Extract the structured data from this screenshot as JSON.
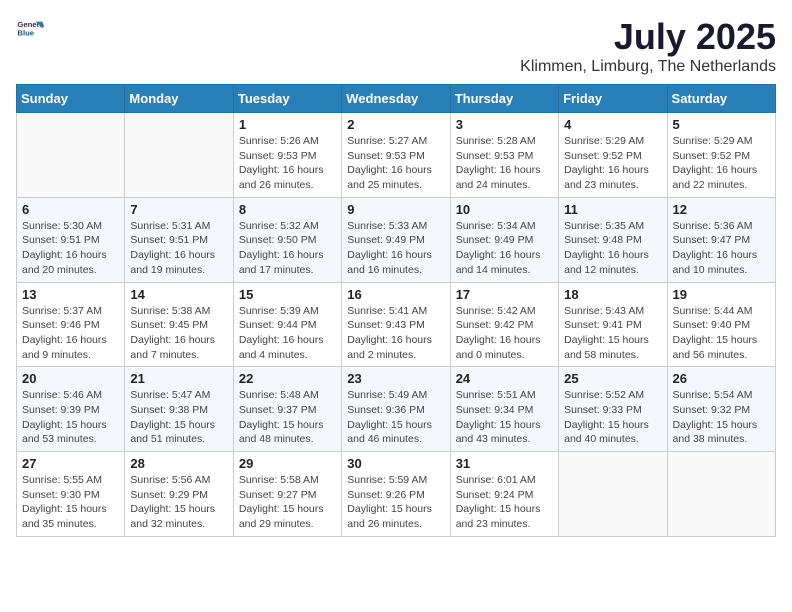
{
  "header": {
    "logo": {
      "general": "General",
      "blue": "Blue"
    },
    "title": "July 2025",
    "location": "Klimmen, Limburg, The Netherlands"
  },
  "calendar": {
    "days_of_week": [
      "Sunday",
      "Monday",
      "Tuesday",
      "Wednesday",
      "Thursday",
      "Friday",
      "Saturday"
    ],
    "weeks": [
      [
        {
          "day": "",
          "content": ""
        },
        {
          "day": "",
          "content": ""
        },
        {
          "day": "1",
          "content": "Sunrise: 5:26 AM\nSunset: 9:53 PM\nDaylight: 16 hours and 26 minutes."
        },
        {
          "day": "2",
          "content": "Sunrise: 5:27 AM\nSunset: 9:53 PM\nDaylight: 16 hours and 25 minutes."
        },
        {
          "day": "3",
          "content": "Sunrise: 5:28 AM\nSunset: 9:53 PM\nDaylight: 16 hours and 24 minutes."
        },
        {
          "day": "4",
          "content": "Sunrise: 5:29 AM\nSunset: 9:52 PM\nDaylight: 16 hours and 23 minutes."
        },
        {
          "day": "5",
          "content": "Sunrise: 5:29 AM\nSunset: 9:52 PM\nDaylight: 16 hours and 22 minutes."
        }
      ],
      [
        {
          "day": "6",
          "content": "Sunrise: 5:30 AM\nSunset: 9:51 PM\nDaylight: 16 hours and 20 minutes."
        },
        {
          "day": "7",
          "content": "Sunrise: 5:31 AM\nSunset: 9:51 PM\nDaylight: 16 hours and 19 minutes."
        },
        {
          "day": "8",
          "content": "Sunrise: 5:32 AM\nSunset: 9:50 PM\nDaylight: 16 hours and 17 minutes."
        },
        {
          "day": "9",
          "content": "Sunrise: 5:33 AM\nSunset: 9:49 PM\nDaylight: 16 hours and 16 minutes."
        },
        {
          "day": "10",
          "content": "Sunrise: 5:34 AM\nSunset: 9:49 PM\nDaylight: 16 hours and 14 minutes."
        },
        {
          "day": "11",
          "content": "Sunrise: 5:35 AM\nSunset: 9:48 PM\nDaylight: 16 hours and 12 minutes."
        },
        {
          "day": "12",
          "content": "Sunrise: 5:36 AM\nSunset: 9:47 PM\nDaylight: 16 hours and 10 minutes."
        }
      ],
      [
        {
          "day": "13",
          "content": "Sunrise: 5:37 AM\nSunset: 9:46 PM\nDaylight: 16 hours and 9 minutes."
        },
        {
          "day": "14",
          "content": "Sunrise: 5:38 AM\nSunset: 9:45 PM\nDaylight: 16 hours and 7 minutes."
        },
        {
          "day": "15",
          "content": "Sunrise: 5:39 AM\nSunset: 9:44 PM\nDaylight: 16 hours and 4 minutes."
        },
        {
          "day": "16",
          "content": "Sunrise: 5:41 AM\nSunset: 9:43 PM\nDaylight: 16 hours and 2 minutes."
        },
        {
          "day": "17",
          "content": "Sunrise: 5:42 AM\nSunset: 9:42 PM\nDaylight: 16 hours and 0 minutes."
        },
        {
          "day": "18",
          "content": "Sunrise: 5:43 AM\nSunset: 9:41 PM\nDaylight: 15 hours and 58 minutes."
        },
        {
          "day": "19",
          "content": "Sunrise: 5:44 AM\nSunset: 9:40 PM\nDaylight: 15 hours and 56 minutes."
        }
      ],
      [
        {
          "day": "20",
          "content": "Sunrise: 5:46 AM\nSunset: 9:39 PM\nDaylight: 15 hours and 53 minutes."
        },
        {
          "day": "21",
          "content": "Sunrise: 5:47 AM\nSunset: 9:38 PM\nDaylight: 15 hours and 51 minutes."
        },
        {
          "day": "22",
          "content": "Sunrise: 5:48 AM\nSunset: 9:37 PM\nDaylight: 15 hours and 48 minutes."
        },
        {
          "day": "23",
          "content": "Sunrise: 5:49 AM\nSunset: 9:36 PM\nDaylight: 15 hours and 46 minutes."
        },
        {
          "day": "24",
          "content": "Sunrise: 5:51 AM\nSunset: 9:34 PM\nDaylight: 15 hours and 43 minutes."
        },
        {
          "day": "25",
          "content": "Sunrise: 5:52 AM\nSunset: 9:33 PM\nDaylight: 15 hours and 40 minutes."
        },
        {
          "day": "26",
          "content": "Sunrise: 5:54 AM\nSunset: 9:32 PM\nDaylight: 15 hours and 38 minutes."
        }
      ],
      [
        {
          "day": "27",
          "content": "Sunrise: 5:55 AM\nSunset: 9:30 PM\nDaylight: 15 hours and 35 minutes."
        },
        {
          "day": "28",
          "content": "Sunrise: 5:56 AM\nSunset: 9:29 PM\nDaylight: 15 hours and 32 minutes."
        },
        {
          "day": "29",
          "content": "Sunrise: 5:58 AM\nSunset: 9:27 PM\nDaylight: 15 hours and 29 minutes."
        },
        {
          "day": "30",
          "content": "Sunrise: 5:59 AM\nSunset: 9:26 PM\nDaylight: 15 hours and 26 minutes."
        },
        {
          "day": "31",
          "content": "Sunrise: 6:01 AM\nSunset: 9:24 PM\nDaylight: 15 hours and 23 minutes."
        },
        {
          "day": "",
          "content": ""
        },
        {
          "day": "",
          "content": ""
        }
      ]
    ]
  }
}
